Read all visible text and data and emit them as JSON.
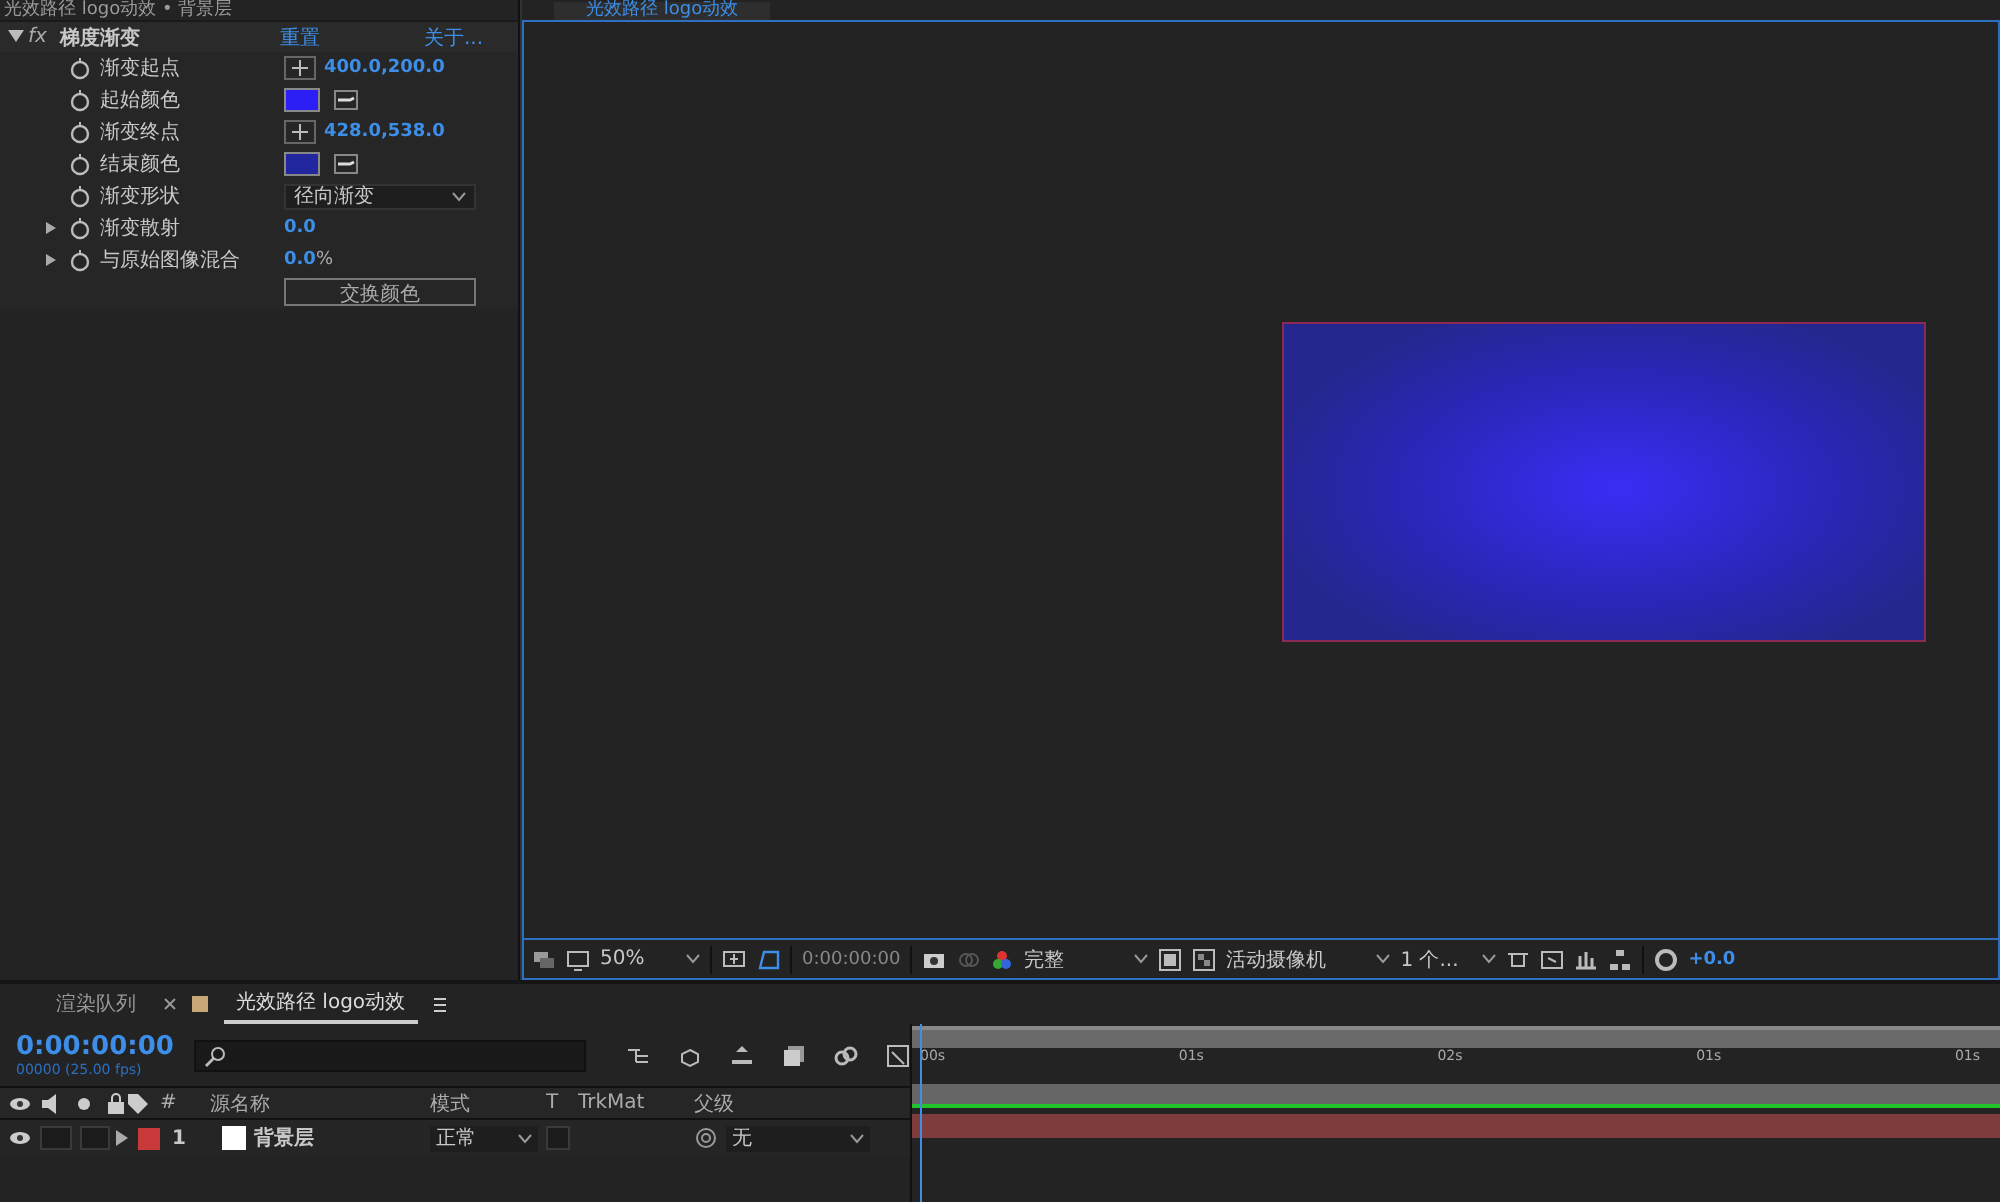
{
  "effect_controls": {
    "title": "光效路径 logo动效 • 背景层",
    "effect": {
      "icon": "fx",
      "name": "梯度渐变",
      "expanded": true,
      "reset": "重置",
      "about": "关于..."
    },
    "properties": [
      {
        "kind": "point",
        "label": "渐变起点",
        "value": "400.0,200.0",
        "twirl": false
      },
      {
        "kind": "color",
        "label": "起始颜色",
        "color": "#2b1ff5",
        "twirl": false
      },
      {
        "kind": "point",
        "label": "渐变终点",
        "value": "428.0,538.0",
        "twirl": false
      },
      {
        "kind": "color",
        "label": "结束颜色",
        "color": "#2227a0",
        "twirl": false
      },
      {
        "kind": "dropdown",
        "label": "渐变形状",
        "value": "径向渐变",
        "twirl": false
      },
      {
        "kind": "number",
        "label": "渐变散射",
        "value": "0.0",
        "twirl": true
      },
      {
        "kind": "number",
        "label": "与原始图像混合",
        "value": "0.0",
        "unit": "%",
        "twirl": true
      },
      {
        "kind": "button",
        "label": "交换颜色"
      }
    ]
  },
  "viewer": {
    "tab": "光效路径 logo动效",
    "toolbar": {
      "zoom": "50%",
      "time": "0:00:00:00",
      "resolution": "完整",
      "camera": "活动摄像机",
      "views": "1 个...",
      "exposure": "+0.0"
    }
  },
  "timeline": {
    "tabs": [
      {
        "label": "渲染队列",
        "selected": false,
        "closable": false
      },
      {
        "label": "光效路径 logo动效",
        "selected": true,
        "closable": true
      }
    ],
    "timecode": "0:00:00:00",
    "fps": "00000 (25.00 fps)",
    "columns": {
      "number": "#",
      "source_name": "源名称",
      "mode": "模式",
      "t": "T",
      "trkmat": "TrkMat",
      "parent": "父级"
    },
    "layers": [
      {
        "number": "1",
        "name": "背景层",
        "color": "#c83a3a",
        "mode": "正常",
        "parent": "无",
        "visible": true,
        "solo": false,
        "locked": false
      }
    ],
    "ruler": [
      "00s",
      "01s",
      "02s",
      "01s",
      "01s"
    ]
  }
}
